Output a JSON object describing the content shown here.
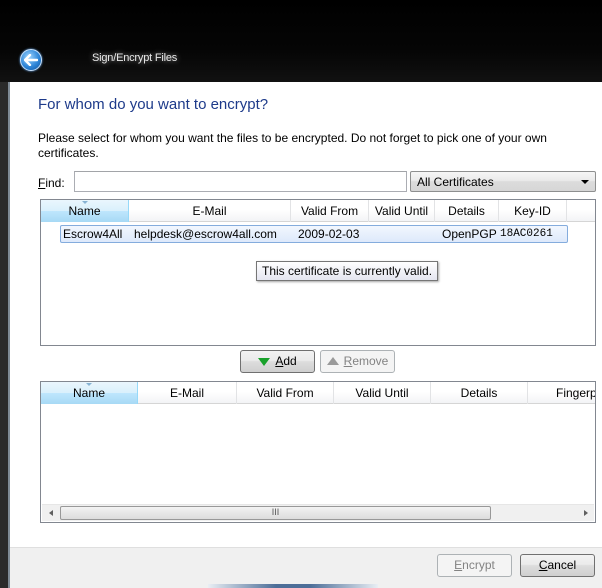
{
  "window": {
    "title": "Sign/Encrypt Files"
  },
  "heading": "For whom do you want to encrypt?",
  "description": "Please select for whom you want the files to be encrypted. Do not forget to pick one of your own certificates.",
  "find": {
    "label_accel": "F",
    "label_rest": "ind:",
    "value": ""
  },
  "filter_combo": {
    "selected": "All Certificates"
  },
  "available_list": {
    "columns": [
      "Name",
      "E-Mail",
      "Valid From",
      "Valid Until",
      "Details",
      "Key-ID"
    ],
    "rows": [
      {
        "name": "Escrow4All",
        "email": "helpdesk@escrow4all.com",
        "valid_from": "2009-02-03",
        "valid_until": "",
        "details": "OpenPGP",
        "key_id": "18AC0261"
      }
    ]
  },
  "tooltip": "This certificate is currently valid.",
  "add_button": {
    "accel": "A",
    "rest": "dd"
  },
  "remove_button": {
    "accel": "R",
    "rest": "emove"
  },
  "selected_list": {
    "columns": [
      "Name",
      "E-Mail",
      "Valid From",
      "Valid Until",
      "Details",
      "Fingerpri"
    ],
    "rows": []
  },
  "scrollbar": {
    "thumb_glyph": "III"
  },
  "footer": {
    "encrypt": {
      "accel": "E",
      "rest": "ncrypt"
    },
    "cancel": {
      "accel": "C",
      "rest": "ancel"
    }
  },
  "colors": {
    "heading": "#1d3a8a",
    "selection": "#dde9fb",
    "add_arrow": "#18a12a"
  }
}
